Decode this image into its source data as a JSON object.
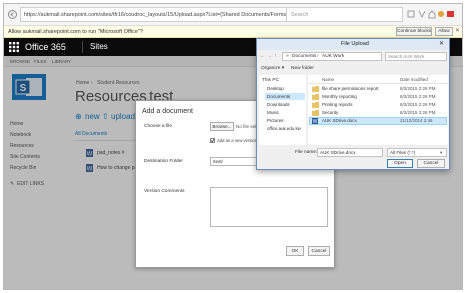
{
  "browser": {
    "url": "https://aukmail.sharepoint.com/sites/tfr16/coudroc_layouts/15/Upload.aspx?List={Shared Documents/Forms/AllItems.aspx?RootFolder=%2F&View",
    "search_placeholder": "Search"
  },
  "infobar": {
    "message": "Allow aukmail.sharepoint.com to run \"Microsoft Office\"?",
    "continue_label": "Continue blocking",
    "allow_label": "Allow"
  },
  "suite": {
    "app_name": "Office 365",
    "sites_label": "Sites"
  },
  "ribbon_tabs": [
    "BROWSE",
    "FILES",
    "LIBRARY"
  ],
  "breadcrumb": {
    "home": "Home",
    "separator": "›",
    "current": "Student Resources"
  },
  "page_title": "Resources",
  "page_title_suffix": "- test",
  "actions": {
    "new_label": "new",
    "upload_label": "upload"
  },
  "view_label": "All Documents",
  "quicklaunch": [
    "Home",
    "Notebook",
    "Resources",
    "Site Contents",
    "Recycle Bin"
  ],
  "edit_links_label": "EDIT LINKS",
  "doc_rows": [
    "pad_notes #",
    "How to change pass"
  ],
  "add_dialog": {
    "title": "Add a document",
    "choose_file_label": "Choose a file",
    "browse_label": "Browse...",
    "no_file_label": "No file selected.",
    "add_version_label": "Add as a new version to existing files",
    "destination_label": "Destination Folder",
    "destination_value": "/test/",
    "comments_label": "Version Comments",
    "ok_label": "OK",
    "cancel_label": "Cancel"
  },
  "file_upload": {
    "title": "File Upload",
    "path_parts": [
      "Documents",
      "AUK Work"
    ],
    "search_placeholder": "Search AUK Work",
    "organize_label": "Organize ▾",
    "new_folder_label": "New folder",
    "col_name": "Name",
    "col_date": "Date modified",
    "nav_items": [
      "This PC",
      "Desktop",
      "Documents",
      "Downloads",
      "Music",
      "Pictures",
      "office.auk.edu.kw"
    ],
    "files": [
      {
        "name": "file share permissions report",
        "date": "8/3/2015 2:26 PM"
      },
      {
        "name": "Monthly reporting",
        "date": "8/3/2015 2:26 PM"
      },
      {
        "name": "Printing reports",
        "date": "8/3/2015 2:26 PM"
      },
      {
        "name": "Security",
        "date": "8/3/2015 2:26 PM"
      },
      {
        "name": "AUK SDrive.docx",
        "date": "21/12/2014 2:46"
      }
    ],
    "file_name_label": "File name:",
    "file_name_value": "AUK SDrive.docx",
    "filter_value": "All Files (*.*)",
    "open_label": "Open",
    "cancel_label": "Cancel"
  },
  "colors": {
    "suite_bar": "#0b0b0b",
    "sharepoint_blue": "#0072c6",
    "selected_row": "#cce8ff"
  }
}
